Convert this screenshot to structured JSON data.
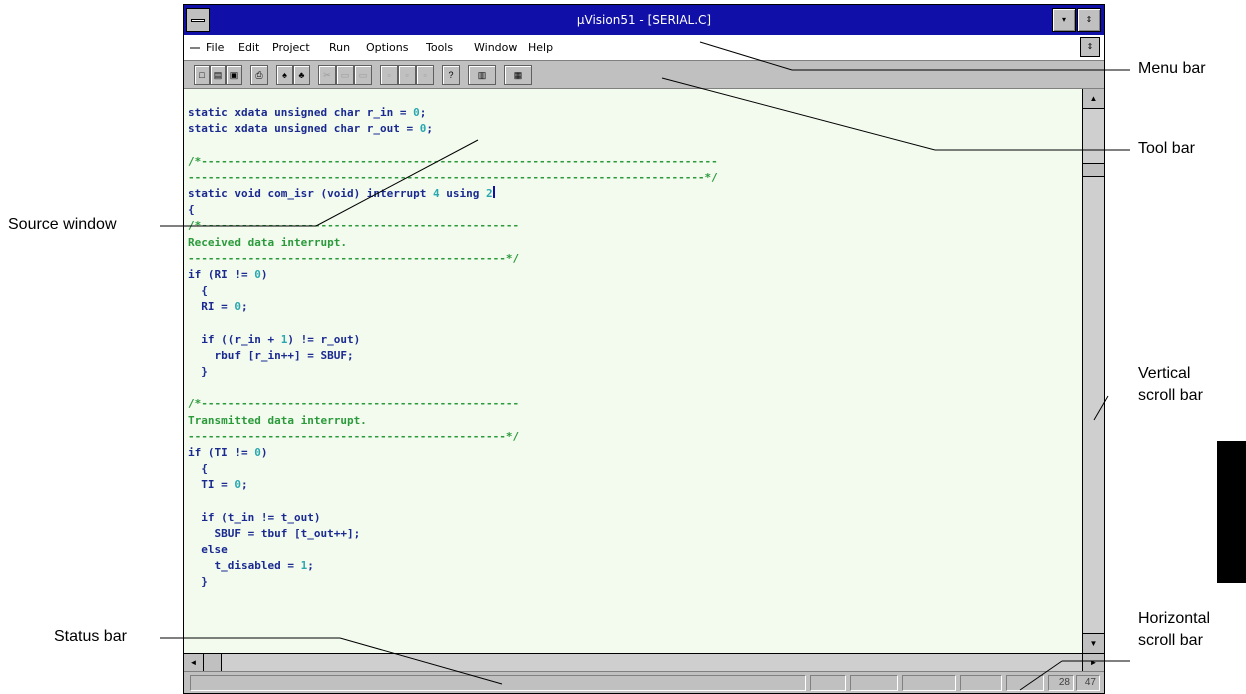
{
  "window": {
    "title": "µVision51 - [SERIAL.C]",
    "minimize_glyph": "▾",
    "maximize_glyph": "⇕",
    "restore_glyph": "⇕"
  },
  "menu": {
    "items": [
      "File",
      "Edit",
      "Project",
      "Run",
      "Options",
      "Tools",
      "Window",
      "Help"
    ]
  },
  "toolbar": {
    "buttons": [
      {
        "icon": "new-file-icon",
        "glyph": "□"
      },
      {
        "icon": "open-file-icon",
        "glyph": "▤"
      },
      {
        "icon": "save-icon",
        "glyph": "▣"
      },
      {
        "icon": "print-icon",
        "glyph": "⎙"
      },
      {
        "icon": "find-icon",
        "glyph": "♠"
      },
      {
        "icon": "find-next-icon",
        "glyph": "♣"
      },
      {
        "icon": "cut-icon",
        "glyph": "✂"
      },
      {
        "icon": "copy-icon",
        "glyph": "▭"
      },
      {
        "icon": "paste-icon",
        "glyph": "▭"
      },
      {
        "icon": "compile-icon",
        "glyph": "▫"
      },
      {
        "icon": "make-icon",
        "glyph": "▫"
      },
      {
        "icon": "build-icon",
        "glyph": "▫"
      },
      {
        "icon": "help-icon",
        "glyph": "?"
      },
      {
        "icon": "debug-icon",
        "glyph": "▥"
      },
      {
        "icon": "tools-icon",
        "glyph": "▦"
      }
    ]
  },
  "source": {
    "lines": [
      {
        "type": "kw",
        "text": "static xdata unsigned char r_in = ",
        "num": "0",
        "after": ";"
      },
      {
        "type": "kw",
        "text": "static xdata unsigned char r_out = ",
        "num": "0",
        "after": ";"
      },
      {
        "type": "blank",
        "text": ""
      },
      {
        "type": "cm",
        "text": "/*------------------------------------------------------------------------------"
      },
      {
        "type": "cm",
        "text": "------------------------------------------------------------------------------*/"
      },
      {
        "type": "kw",
        "text": "static void com_isr (void) interrupt ",
        "num": "4",
        "after": " using ",
        "num2": "2",
        "caret": true
      },
      {
        "type": "kw",
        "text": "{"
      },
      {
        "type": "cm",
        "text": "/*------------------------------------------------"
      },
      {
        "type": "cm",
        "text": "Received data interrupt."
      },
      {
        "type": "cm",
        "text": "------------------------------------------------*/"
      },
      {
        "type": "kw",
        "text": "if (RI != ",
        "num": "0",
        "after": ")"
      },
      {
        "type": "kw",
        "text": "  {"
      },
      {
        "type": "kw",
        "text": "  RI = ",
        "num": "0",
        "after": ";"
      },
      {
        "type": "blank",
        "text": ""
      },
      {
        "type": "kw",
        "text": "  if ((r_in + ",
        "num": "1",
        "after": ") != r_out)"
      },
      {
        "type": "kw",
        "text": "    rbuf [r_in++] = SBUF;"
      },
      {
        "type": "kw",
        "text": "  }"
      },
      {
        "type": "blank",
        "text": ""
      },
      {
        "type": "cm",
        "text": "/*------------------------------------------------"
      },
      {
        "type": "cm",
        "text": "Transmitted data interrupt."
      },
      {
        "type": "cm",
        "text": "------------------------------------------------*/"
      },
      {
        "type": "kw",
        "text": "if (TI != ",
        "num": "0",
        "after": ")"
      },
      {
        "type": "kw",
        "text": "  {"
      },
      {
        "type": "kw",
        "text": "  TI = ",
        "num": "0",
        "after": ";"
      },
      {
        "type": "blank",
        "text": ""
      },
      {
        "type": "kw",
        "text": "  if (t_in != t_out)"
      },
      {
        "type": "kw",
        "text": "    SBUF = tbuf [t_out++];"
      },
      {
        "type": "kw",
        "text": "  else"
      },
      {
        "type": "kw",
        "text": "    t_disabled = ",
        "num": "1",
        "after": ";"
      },
      {
        "type": "kw",
        "text": "  }"
      }
    ]
  },
  "scrollbars": {
    "up_glyph": "▲",
    "down_glyph": "▼",
    "left_glyph": "◄",
    "right_glyph": "►"
  },
  "status": {
    "line": "28",
    "column": "47"
  },
  "callouts": {
    "menu_bar": "Menu bar",
    "tool_bar": "Tool bar",
    "source_window": "Source window",
    "vertical_scroll": "Vertical scroll bar",
    "status_bar": "Status bar",
    "horizontal_scroll": "Horizontal scroll bar"
  },
  "colors": {
    "titlebar": "#1010a8",
    "editor_bg": "#f3fbef",
    "keyword": "#1a2a90",
    "comment": "#2a9a3a",
    "number": "#2aa8b0"
  }
}
